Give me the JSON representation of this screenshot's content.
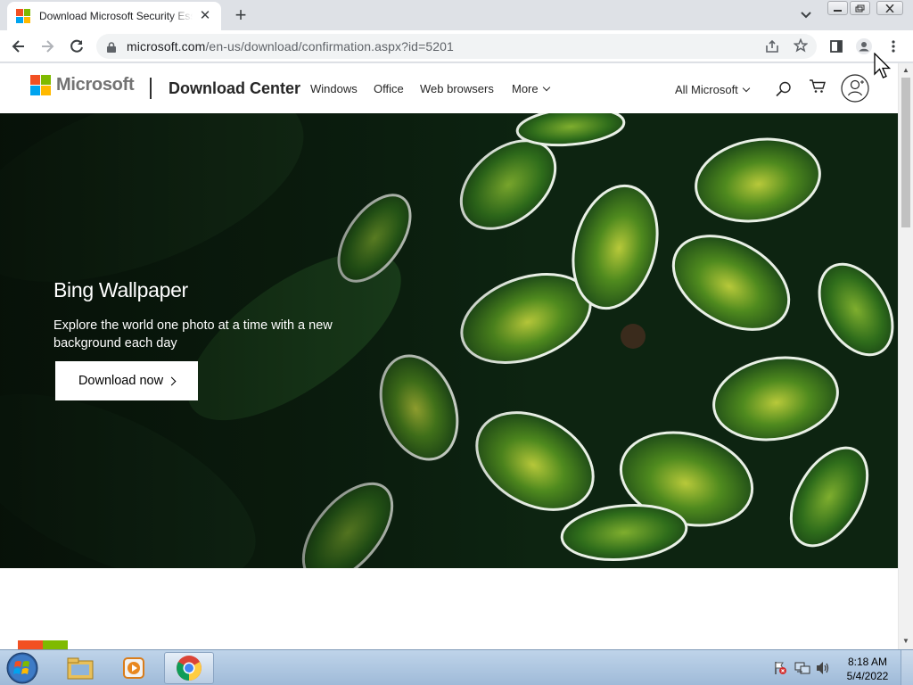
{
  "browser": {
    "tab": {
      "title": "Download Microsoft Security Essentials"
    },
    "url": {
      "host": "microsoft.com",
      "path": "/en-us/download/confirmation.aspx?id=5201"
    }
  },
  "site": {
    "logo_text": "Microsoft",
    "title": "Download Center",
    "nav": [
      "Windows",
      "Office",
      "Web browsers",
      "More"
    ],
    "all_microsoft": "All Microsoft"
  },
  "hero": {
    "title": "Bing Wallpaper",
    "description": "Explore the world one photo at a time with a new background each day",
    "button_label": "Download now"
  },
  "taskbar": {
    "time": "8:18 AM",
    "date": "5/4/2022"
  },
  "colors": {
    "ms_red": "#f25022",
    "ms_green": "#7fba00",
    "ms_blue": "#00a4ef",
    "ms_yellow": "#ffb900"
  }
}
